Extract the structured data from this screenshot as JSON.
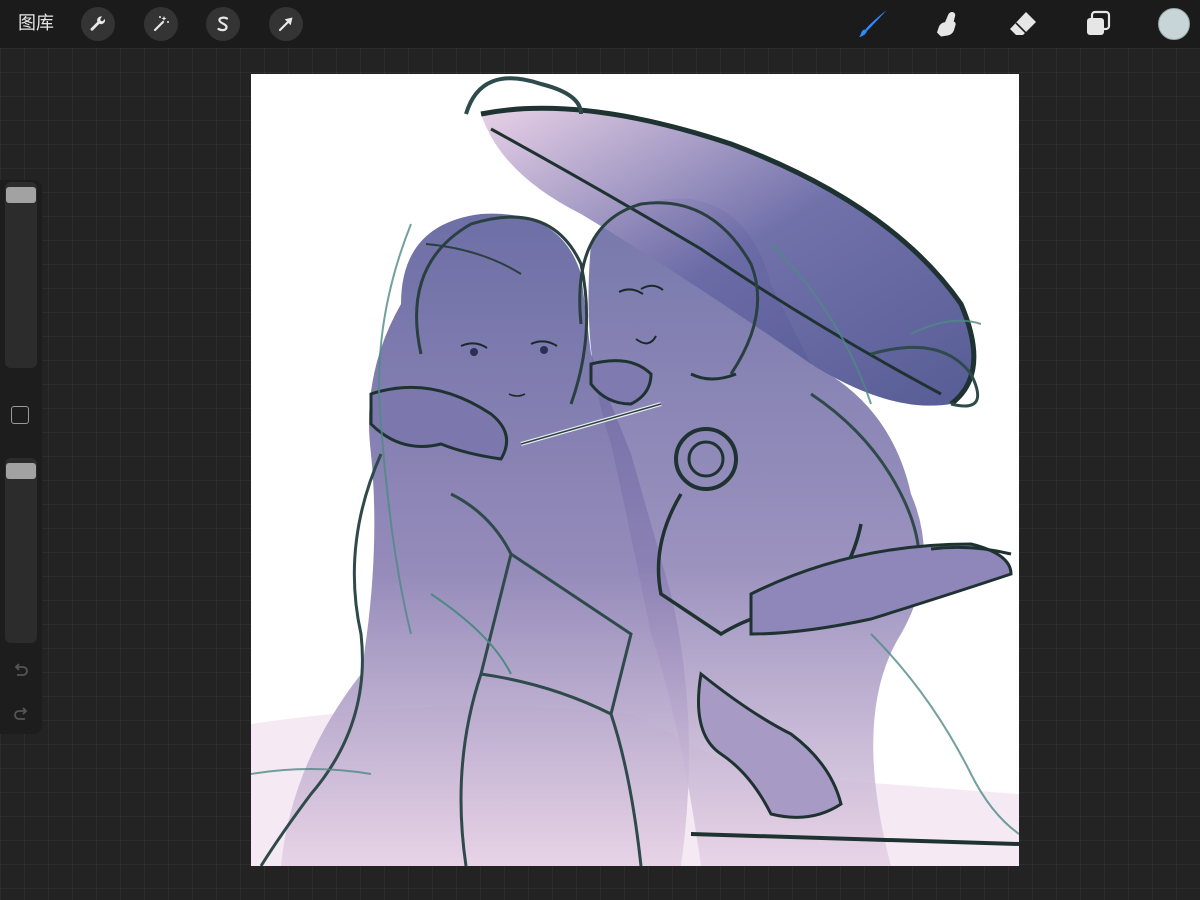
{
  "topbar": {
    "gallery_label": "图库",
    "left_tools": [
      {
        "name": "actions",
        "icon": "wrench-icon"
      },
      {
        "name": "adjustments",
        "icon": "magic-wand-icon"
      },
      {
        "name": "selection",
        "icon": "selection-s-icon"
      },
      {
        "name": "transform",
        "icon": "arrow-cursor-icon"
      }
    ],
    "right_tools": [
      {
        "name": "brush",
        "icon": "brush-icon",
        "active": true
      },
      {
        "name": "smudge",
        "icon": "smudge-finger-icon"
      },
      {
        "name": "eraser",
        "icon": "eraser-icon"
      },
      {
        "name": "layers",
        "icon": "layers-icon"
      }
    ],
    "current_color": "#c8d5d8",
    "active_tool_color": "#2d8cff"
  },
  "sidebar": {
    "brush_size_level": 0.98,
    "opacity_level": 0.98,
    "modify_button_icon": "square-icon",
    "undo_icon": "undo-arrow-icon",
    "redo_icon": "redo-arrow-icon"
  },
  "canvas": {
    "content": "sketch-artwork",
    "palette": {
      "line": "#223636",
      "line_teal": "#4e8a84",
      "shade_purple": "#5b5f9a",
      "shade_pink": "#e6cfe3",
      "background": "#ffffff"
    }
  }
}
